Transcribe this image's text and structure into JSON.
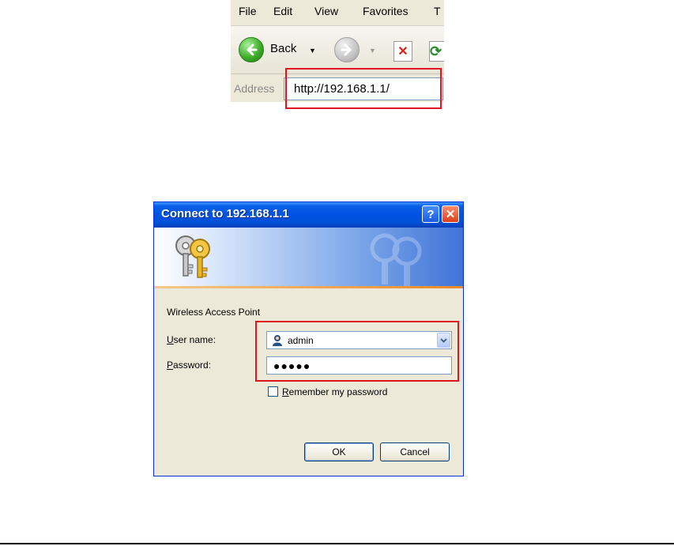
{
  "browser": {
    "menu": [
      "File",
      "Edit",
      "View",
      "Favorites",
      "T"
    ],
    "back_label": "Back",
    "address_label": "Address",
    "url": "http://192.168.1.1/",
    "highlight_color": "#e0141e"
  },
  "dialog": {
    "title": "Connect to 192.168.1.1",
    "device_name": "Wireless Access Point",
    "username_label_accel": "U",
    "username_label_rest": "ser name:",
    "username_value": "admin",
    "password_label_accel": "P",
    "password_label_rest": "assword:",
    "password_value": "●●●●●",
    "remember_accel": "R",
    "remember_rest": "emember my password",
    "remember_checked": false,
    "ok_label": "OK",
    "cancel_label": "Cancel",
    "icons": {
      "banner": "keys-icon",
      "help": "help-icon",
      "close": "close-icon",
      "user": "user-icon",
      "dropdown": "chevron-down-icon"
    }
  }
}
